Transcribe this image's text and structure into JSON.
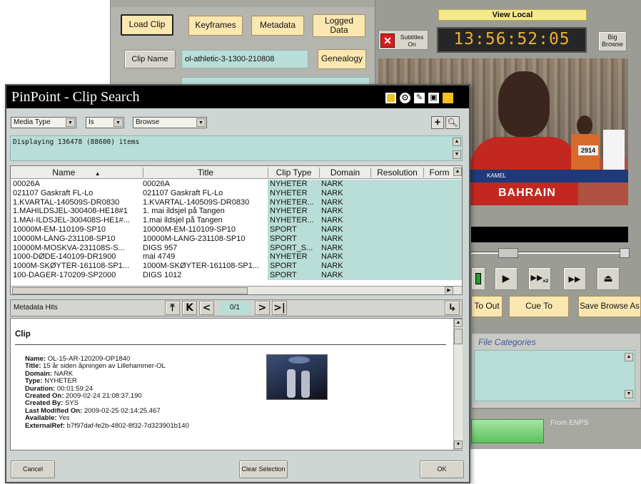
{
  "bg_app": {
    "buttons": {
      "load_clip": "Load Clip",
      "keyframes": "Keyframes",
      "metadata": "Metadata",
      "logged_data": "Logged Data",
      "clip_name": "Clip Name",
      "genealogy": "Genealogy"
    },
    "clip_name_value": "ol-athletic-3-1300-210808",
    "view_local": "View Local",
    "subtitles": "Subtitles On",
    "timecode": "13:56:52:05",
    "big_browse": "Big Browse",
    "to_out": "To Out",
    "cue_to": "Cue To",
    "save_browse_as": "Save Browse As",
    "file_categories": "File Categories",
    "from_enps": "From ENPS",
    "video": {
      "name_caption": "KAMEL",
      "bib": "2914",
      "flag_text": "BAHRAIN"
    }
  },
  "dialog": {
    "title": "PinPoint - Clip Search",
    "filter": {
      "field": "Media Type",
      "op": "Is",
      "value": "Browse"
    },
    "status": "Displaying 136478 (88600) items",
    "columns": [
      "Name",
      "Title",
      "Clip Type",
      "Domain",
      "Resolution",
      "Form"
    ],
    "rows": [
      [
        "00026A",
        "00026A",
        "NYHETER",
        "NARK"
      ],
      [
        "021107 Gaskraft FL-Lo",
        "021107 Gaskraft FL-Lo",
        "NYHETER",
        "NARK"
      ],
      [
        "1.KVARTAL-140509S-DR0830",
        "1.KVARTAL-140509S-DR0830",
        "NYHETER...",
        "NARK"
      ],
      [
        "1.MAHILDSJEL-300408-HE18#1",
        "1. mai ildsjel på Tangen",
        "NYHETER",
        "NARK"
      ],
      [
        "1.MAI-ILDSJEL-300408S-HE1#...",
        "1.mai ildsjel på Tangen",
        "NYHETER...",
        "NARK"
      ],
      [
        "10000M-EM-110109-SP10",
        "10000M-EM-110109-SP10",
        "SPORT",
        "NARK"
      ],
      [
        "10000M-LANG-231108-SP10",
        "10000M-LANG-231108-SP10",
        "SPORT",
        "NARK"
      ],
      [
        "10000M-MOSKVA-231108S-S...",
        "DIGS 957",
        "SPORT_S...",
        "NARK"
      ],
      [
        "1000-DØDE-140109-DR1900",
        "mai 4749",
        "NYHETER",
        "NARK"
      ],
      [
        "1000M-SKØYTER-161108-SP1...",
        "1000M-SKØYTER-161108-SP1...",
        "SPORT",
        "NARK"
      ],
      [
        "100-DAGER-170209-SP2000",
        "DIGS 1012",
        "SPORT",
        "NARK"
      ]
    ],
    "metadata_hits": "Metadata Hits",
    "page": "0/1",
    "section": "Clip",
    "meta": [
      {
        "label": "Name:",
        "value": "OL-15-AR-120209-OP1840"
      },
      {
        "label": "Title:",
        "value": "15 år siden åpningen av Lillehammer-OL"
      },
      {
        "label": "Domain:",
        "value": "NARK"
      },
      {
        "label": "Type:",
        "value": "NYHETER"
      },
      {
        "label": "Duration:",
        "value": "00:01:59:24"
      },
      {
        "label": "Created On:",
        "value": "2009-02-24 21:08:37.190"
      },
      {
        "label": "Created By:",
        "value": "SYS"
      },
      {
        "label": "Last Modified On:",
        "value": "2009-02-25 02:14:25.467"
      },
      {
        "label": "Available:",
        "value": "Yes"
      },
      {
        "label": "ExternalRef:",
        "value": "b7f97daf-fe2b-4802-8f32-7d323901b140"
      }
    ],
    "cancel": "Cancel",
    "clear_selection": "Clear Selection",
    "ok": "OK"
  },
  "colors": {
    "teal": "#b9ddd7",
    "yellow_button": "#fbe7b0",
    "timecode": "#f0b030",
    "panel": "#b0b0aa"
  }
}
